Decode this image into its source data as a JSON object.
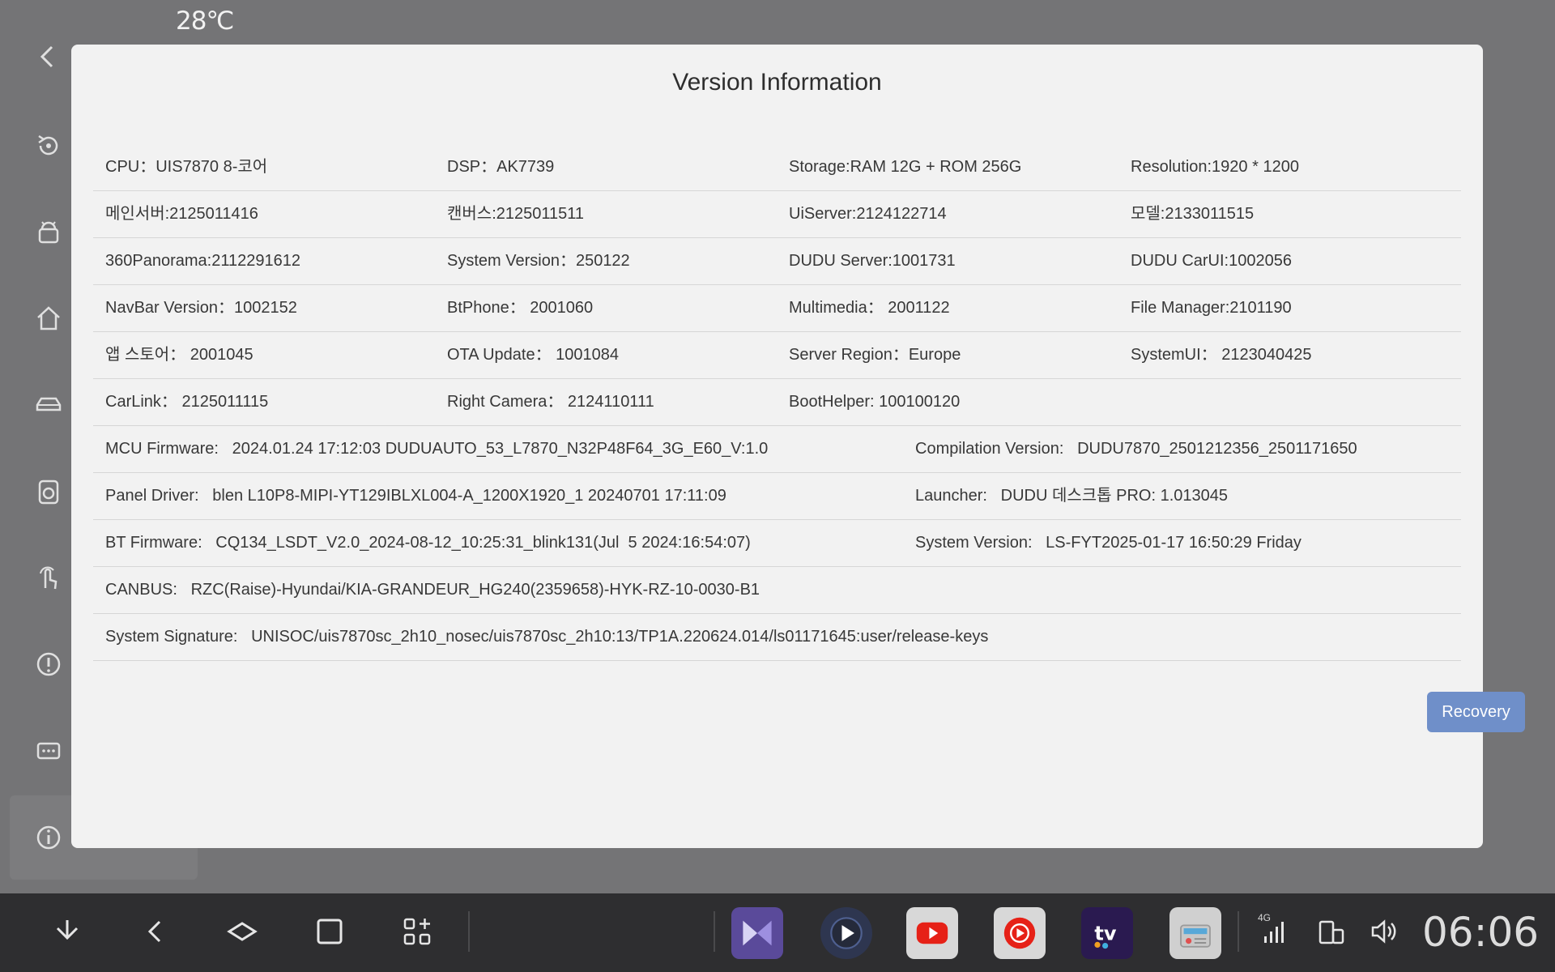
{
  "status": {
    "temperature": "28℃"
  },
  "dialog": {
    "title": "Version Information",
    "rows4": [
      [
        "CPU：UIS7870 8-코어",
        "DSP：AK7739",
        "Storage:RAM 12G + ROM 256G",
        "Resolution:1920 * 1200"
      ],
      [
        "메인서버:2125011416",
        "캔버스:2125011511",
        "UiServer:2124122714",
        "모델:2133011515"
      ],
      [
        "360Panorama:2112291612",
        "System Version：250122",
        "DUDU Server:1001731",
        "DUDU CarUI:1002056"
      ],
      [
        "NavBar Version：1002152",
        "BtPhone： 2001060",
        "Multimedia： 2001122",
        "File Manager:2101190"
      ],
      [
        "앱 스토어： 2001045",
        "OTA Update： 1001084",
        "Server Region：Europe",
        "SystemUI： 2123040425"
      ],
      [
        "CarLink： 2125011115",
        "Right Camera： 2124110111",
        "BootHelper: 100100120",
        ""
      ]
    ],
    "rows2": [
      [
        "MCU Firmware:   2024.01.24 17:12:03 DUDUAUTO_53_L7870_N32P48F64_3G_E60_V:1.0",
        "Compilation Version:   DUDU7870_2501212356_2501171650"
      ],
      [
        "Panel Driver:   blen L10P8-MIPI-YT129IBLXL004-A_1200X1920_1 20240701 17:11:09",
        "Launcher:   DUDU 데스크톱 PRO: 1.013045"
      ],
      [
        "BT Firmware:   CQ134_LSDT_V2.0_2024-08-12_10:25:31_blink131(Jul  5 2024:16:54:07)",
        "System Version:   LS-FYT2025-01-17 16:50:29 Friday"
      ]
    ],
    "rows1": [
      "CANBUS:   RZC(Raise)-Hyundai/KIA-GRANDEUR_HG240(2359658)-HYK-RZ-10-0030-B1",
      "System Signature:   UNISOC/uis7870sc_2h10_nosec/uis7870sc_2h10:13/TP1A.220624.014/ls01171645:user/release-keys"
    ],
    "recovery_label": "Recovery"
  },
  "taskbar": {
    "network": "4G",
    "clock": "06:06",
    "apps": [
      "video-player-app",
      "media-play-app",
      "youtube-app",
      "youtube-music-app",
      "hd-tv-app",
      "radio-app"
    ]
  },
  "colors": {
    "accent": "#6f8fc9",
    "dialog_bg": "#f2f2f2",
    "taskbar_bg": "#2e2e30"
  }
}
